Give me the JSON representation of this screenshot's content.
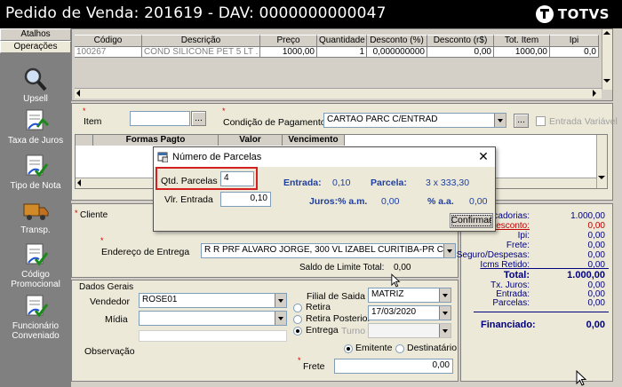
{
  "window": {
    "title": "Pedido de Venda: 201619  - DAV: 0000000000047",
    "brand": "TOTVS"
  },
  "sidebar": {
    "tabs": [
      "Atalhos",
      "Operações"
    ],
    "items": [
      {
        "label": "Upsell",
        "icon": "magnifier-icon"
      },
      {
        "label": "Taxa de Juros",
        "icon": "percent-document-icon"
      },
      {
        "label": "Tipo de Nota",
        "icon": "document-check-icon"
      },
      {
        "label": "Transp.",
        "icon": "truck-icon"
      },
      {
        "label": "Código\nPromocional",
        "icon": "document-check-icon"
      },
      {
        "label": "Funcionário\nConveniado",
        "icon": "document-check-icon"
      }
    ]
  },
  "items_grid": {
    "headers": [
      "Código",
      "Descrição",
      "Preço",
      "Quantidade",
      "Desconto (%)",
      "Desconto (r$)",
      "Tot. Item",
      "Ipi"
    ],
    "row": [
      "100267",
      "COND SILICONE PET 5 LT  . .",
      "1000,00",
      "1",
      "0,000000000",
      "0,00",
      "1000,00",
      "0,0"
    ]
  },
  "payment": {
    "item_label": "Item",
    "ellipsis": "...",
    "condicao_label": "Condição de Pagamento",
    "condicao_value": "CARTAO PARC C/ENTRAD",
    "entrada_variavel_label": "Entrada Variável",
    "columns": [
      "Formas Pagto",
      "Valor",
      "Vencimento"
    ]
  },
  "dialog": {
    "title": "Número de Parcelas",
    "qtd_label": "Qtd. Parcelas",
    "qtd_value": "4",
    "vlr_label": "Vlr. Entrada",
    "vlr_value": "0,10",
    "entrada_label": "Entrada:",
    "entrada_value": "0,10",
    "parcela_label": "Parcela:",
    "parcela_value": "3 x 333,30",
    "juros_am_label": "Juros:% a.m.",
    "juros_am_value": "0,00",
    "juros_aa_label": "% a.a.",
    "juros_aa_value": "0,00",
    "confirm_label": "Confirmar"
  },
  "cliente": {
    "section_label": "Cliente",
    "endereco_label": "Endereço de Entrega",
    "endereco_value": "R  R PRF ALVARO JORGE, 300  VL IZABEL CURITIBA-PR CEP:",
    "saldo_label": "Saldo de Limite Total:",
    "saldo_value": "0,00"
  },
  "dados_gerais": {
    "section_label": "Dados Gerais",
    "vendedor_label": "Vendedor",
    "vendedor_value": "ROSE01",
    "midia_label": "Mídia",
    "observacao_label": "Observação",
    "filial_label": "Filial de Saida",
    "filial_value": "MATRIZ",
    "retira_label": "Retira",
    "retira_posterior_label": "Retira Posterior",
    "retira_posterior_date": "17/03/2020",
    "entrega_label": "Entrega",
    "turno_label": "Turno",
    "emitente_label": "Emitente",
    "destinatario_label": "Destinatário",
    "frete_label": "Frete",
    "frete_value": "0,00"
  },
  "totals": {
    "rows": [
      {
        "label": "rcadorias:",
        "value": "1.000,00",
        "color": "#000080"
      },
      {
        "label": "Desconto:",
        "value": "0,00",
        "color": "#c00000"
      },
      {
        "label": "Ipi:",
        "value": "0,00",
        "color": "#000080"
      },
      {
        "label": "Frete:",
        "value": "0,00",
        "color": "#000080"
      },
      {
        "label": "Seguro/Despesas:",
        "value": "0,00",
        "color": "#000080"
      },
      {
        "label": "Icms Retido:",
        "value": "0,00",
        "color": "#000080"
      }
    ],
    "total_label": "Total:",
    "total_value": "1.000,00",
    "tx_juros_label": "Tx. Juros:",
    "tx_juros_value": "0,00",
    "entrada_label": "Entrada:",
    "entrada_value": "0,00",
    "parcelas_label": "Parcelas:",
    "parcelas_value": "0,00",
    "financiado_label": "Financiado:",
    "financiado_value": "0,00"
  }
}
